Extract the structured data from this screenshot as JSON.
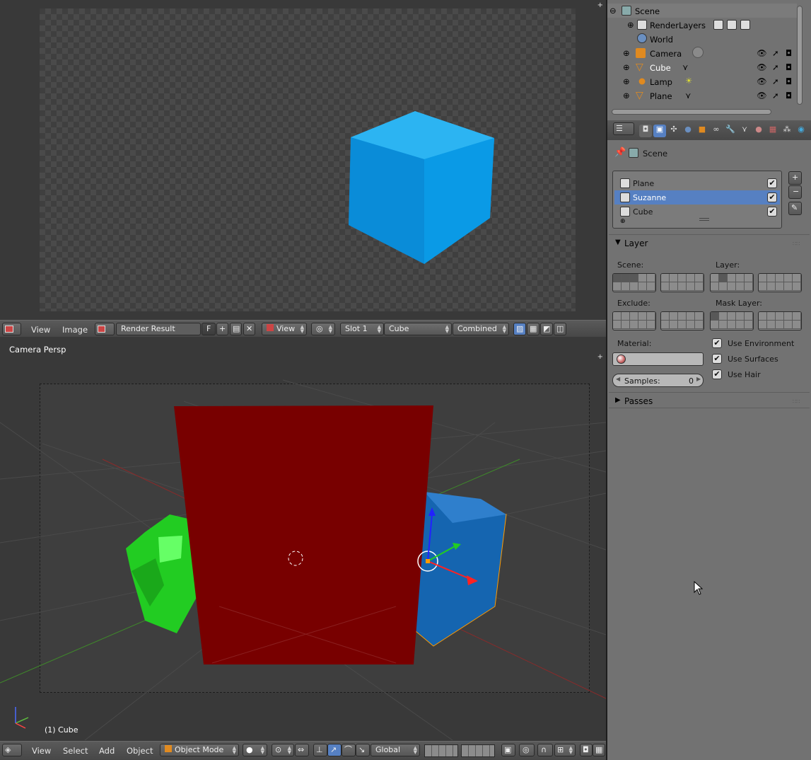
{
  "image_editor": {
    "header": {
      "view": "View",
      "image": "Image",
      "image_name": "Render Result",
      "fake_user": "F",
      "view_mode": "View",
      "slot": "Slot 1",
      "layer": "Cube",
      "pass": "Combined"
    }
  },
  "view3d": {
    "title": "Camera Persp",
    "object_label": "(1) Cube",
    "header": {
      "view": "View",
      "select": "Select",
      "add": "Add",
      "object": "Object",
      "mode": "Object Mode",
      "orientation": "Global"
    }
  },
  "outliner": {
    "rows": [
      {
        "label": "Scene"
      },
      {
        "label": "RenderLayers"
      },
      {
        "label": "World"
      },
      {
        "label": "Camera"
      },
      {
        "label": "Cube"
      },
      {
        "label": "Lamp"
      },
      {
        "label": "Plane"
      }
    ]
  },
  "properties": {
    "context": "Scene",
    "render_layers": [
      {
        "label": "Plane",
        "checked": true,
        "selected": false
      },
      {
        "label": "Suzanne",
        "checked": true,
        "selected": true
      },
      {
        "label": "Cube",
        "checked": true,
        "selected": false
      }
    ],
    "layer_panel": {
      "title": "Layer",
      "scene_label": "Scene:",
      "layer_label": "Layer:",
      "exclude_label": "Exclude:",
      "mask_layer_label": "Mask Layer:",
      "material_label": "Material:",
      "use_environment": "Use Environment",
      "use_surfaces": "Use Surfaces",
      "use_hair": "Use Hair",
      "samples_label": "Samples:",
      "samples_value": "0"
    },
    "passes_panel": {
      "title": "Passes"
    }
  },
  "colors": {
    "cube_render": "#0a9ae6",
    "plane_red": "#780000",
    "suzanne_green": "#22cc22",
    "cube_view": "#1565b0",
    "selected_row": "#5680c2"
  }
}
